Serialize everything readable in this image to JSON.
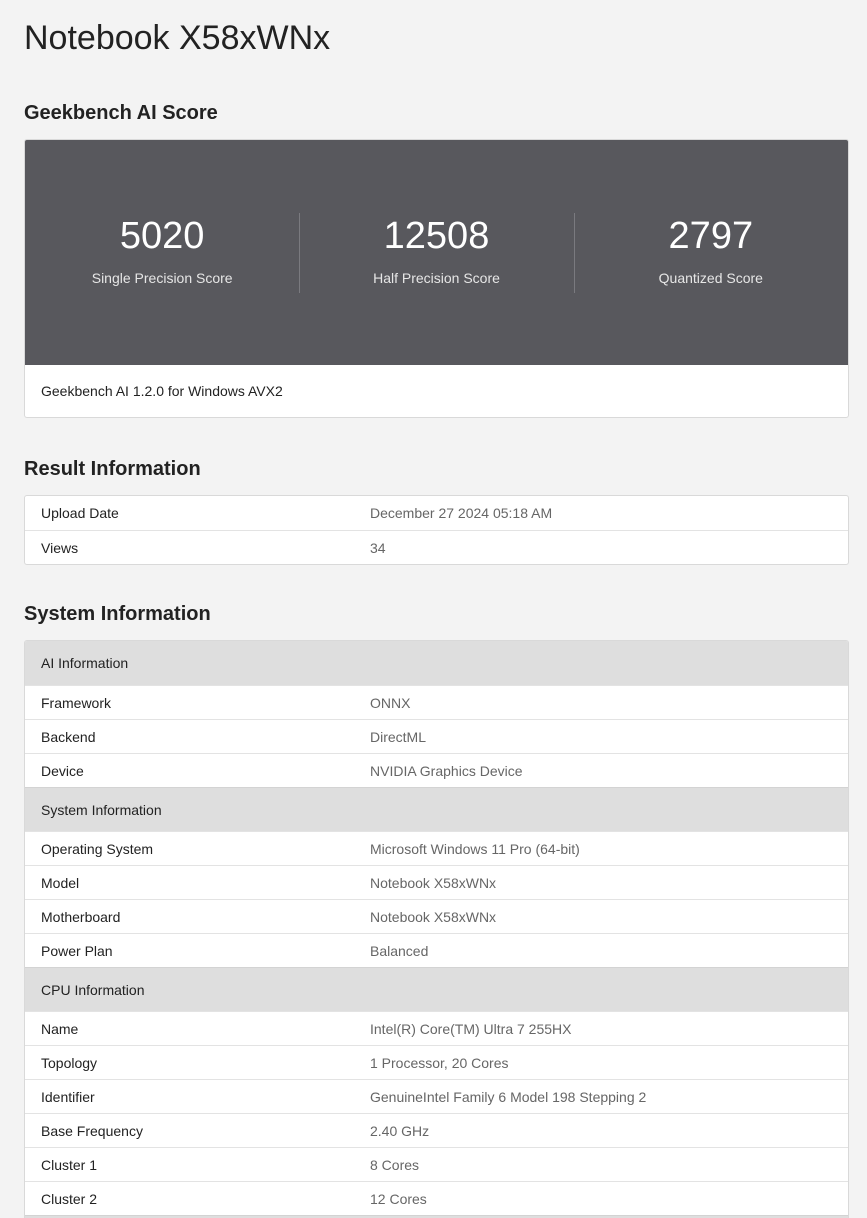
{
  "page": {
    "title": "Notebook X58xWNx"
  },
  "score": {
    "section_title": "Geekbench AI Score",
    "items": [
      {
        "value": "5020",
        "label": "Single Precision Score"
      },
      {
        "value": "12508",
        "label": "Half Precision Score"
      },
      {
        "value": "2797",
        "label": "Quantized Score"
      }
    ],
    "footer": "Geekbench AI 1.2.0 for Windows AVX2"
  },
  "result": {
    "section_title": "Result Information",
    "rows": [
      {
        "k": "Upload Date",
        "v": "December 27 2024 05:18 AM"
      },
      {
        "k": "Views",
        "v": "34"
      }
    ]
  },
  "system": {
    "section_title": "System Information",
    "groups": [
      {
        "title": "AI Information",
        "rows": [
          {
            "k": "Framework",
            "v": "ONNX"
          },
          {
            "k": "Backend",
            "v": "DirectML"
          },
          {
            "k": "Device",
            "v": "NVIDIA Graphics Device"
          }
        ]
      },
      {
        "title": "System Information",
        "rows": [
          {
            "k": "Operating System",
            "v": "Microsoft Windows 11 Pro (64-bit)"
          },
          {
            "k": "Model",
            "v": "Notebook X58xWNx"
          },
          {
            "k": "Motherboard",
            "v": "Notebook X58xWNx"
          },
          {
            "k": "Power Plan",
            "v": "Balanced"
          }
        ]
      },
      {
        "title": "CPU Information",
        "rows": [
          {
            "k": "Name",
            "v": "Intel(R) Core(TM) Ultra 7 255HX"
          },
          {
            "k": "Topology",
            "v": "1 Processor, 20 Cores"
          },
          {
            "k": "Identifier",
            "v": "GenuineIntel Family 6 Model 198 Stepping 2"
          },
          {
            "k": "Base Frequency",
            "v": "2.40 GHz"
          },
          {
            "k": "Cluster 1",
            "v": "8 Cores"
          },
          {
            "k": "Cluster 2",
            "v": "12 Cores"
          }
        ]
      }
    ]
  }
}
